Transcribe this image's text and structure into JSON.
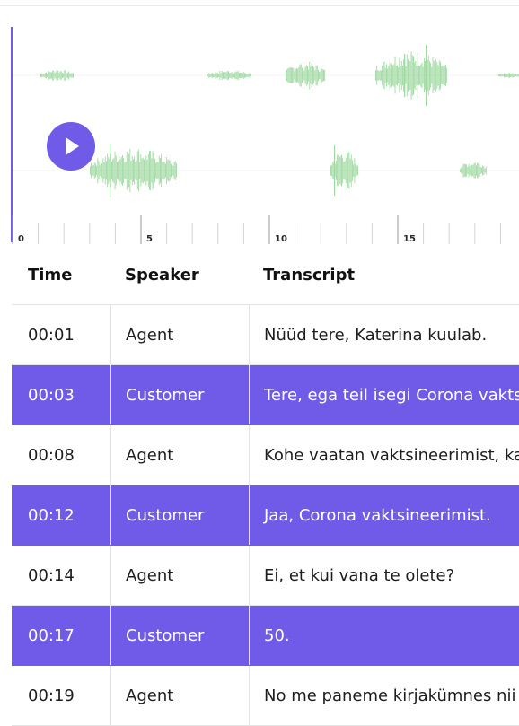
{
  "player": {
    "accent_color": "#6f5be7",
    "wave_color": "#9fd9a1",
    "play_icon": "play-icon",
    "timeline_labels": [
      "0",
      "5",
      "10",
      "15"
    ]
  },
  "table": {
    "headers": {
      "time": "Time",
      "speaker": "Speaker",
      "transcript": "Transcript"
    },
    "rows": [
      {
        "time": "00:01",
        "speaker": "Agent",
        "text": "Nüüd tere, Katerina kuulab.",
        "highlighted": false
      },
      {
        "time": "00:03",
        "speaker": "Customer",
        "text": "Tere, ega teil isegi Corona vaktsineerimist",
        "highlighted": true
      },
      {
        "time": "00:08",
        "speaker": "Agent",
        "text": "Kohe vaatan vaktsineerimist, kas",
        "highlighted": false
      },
      {
        "time": "00:12",
        "speaker": "Customer",
        "text": "Jaa, Corona vaktsineerimist.",
        "highlighted": true
      },
      {
        "time": "00:14",
        "speaker": "Agent",
        "text": "Ei, et kui vana te olete?",
        "highlighted": false
      },
      {
        "time": "00:17",
        "speaker": "Customer",
        "text": "50.",
        "highlighted": true
      },
      {
        "time": "00:19",
        "speaker": "Agent",
        "text": "No me paneme kirjakümnes nii",
        "highlighted": false
      }
    ]
  }
}
